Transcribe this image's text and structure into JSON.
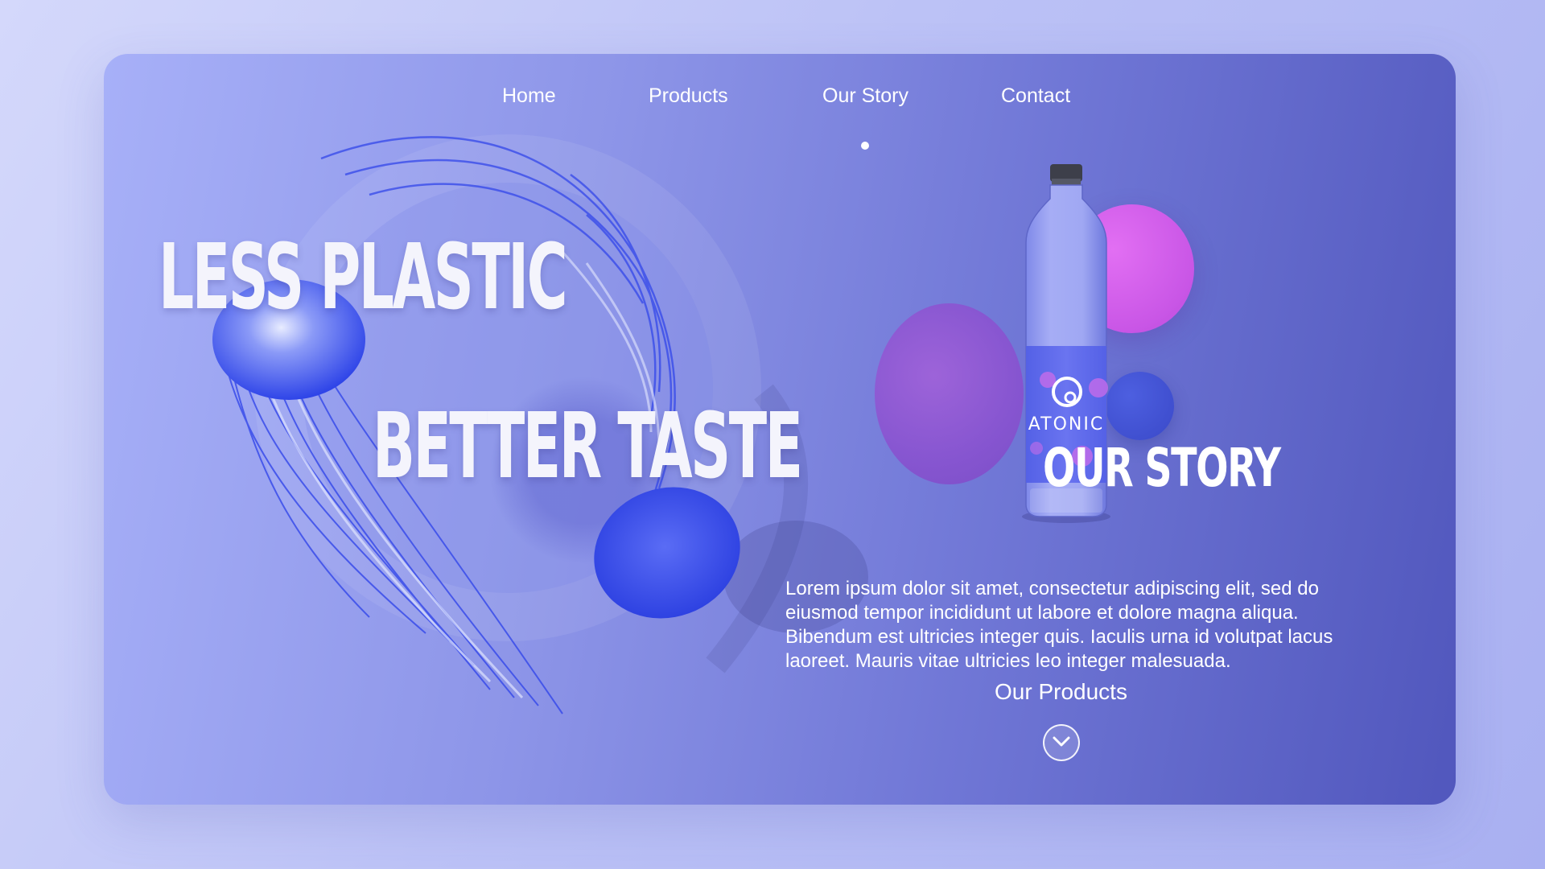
{
  "nav": {
    "items": [
      {
        "label": "Home"
      },
      {
        "label": "Products"
      },
      {
        "label": "Our Story"
      },
      {
        "label": "Contact"
      }
    ],
    "active": "Our Story"
  },
  "hero": {
    "line1": "LESS PLASTIC",
    "line2": "BETTER TASTE"
  },
  "product": {
    "brand": "ATONIC"
  },
  "story": {
    "title": "OUR STORY",
    "body": "Lorem ipsum dolor sit amet, consectetur adipiscing elit, sed do eiusmod tempor incididunt ut labore et dolore magna aliqua. Bibendum est ultricies integer quis. Iaculis urna id volutpat lacus laoreet. Mauris vitae ultricies leo integer malesuada."
  },
  "cta": {
    "label": "Our Products",
    "icon": "chevron-down-icon"
  },
  "colors": {
    "bg_light": "#d4d8fb",
    "card_start": "#a7b0f8",
    "card_end": "#5157bd",
    "bubble_purple": "#8a4fcf",
    "bubble_pink": "#c956e6",
    "bubble_blue": "#3a49c9",
    "jelly_blue": "#3b4ff0"
  }
}
